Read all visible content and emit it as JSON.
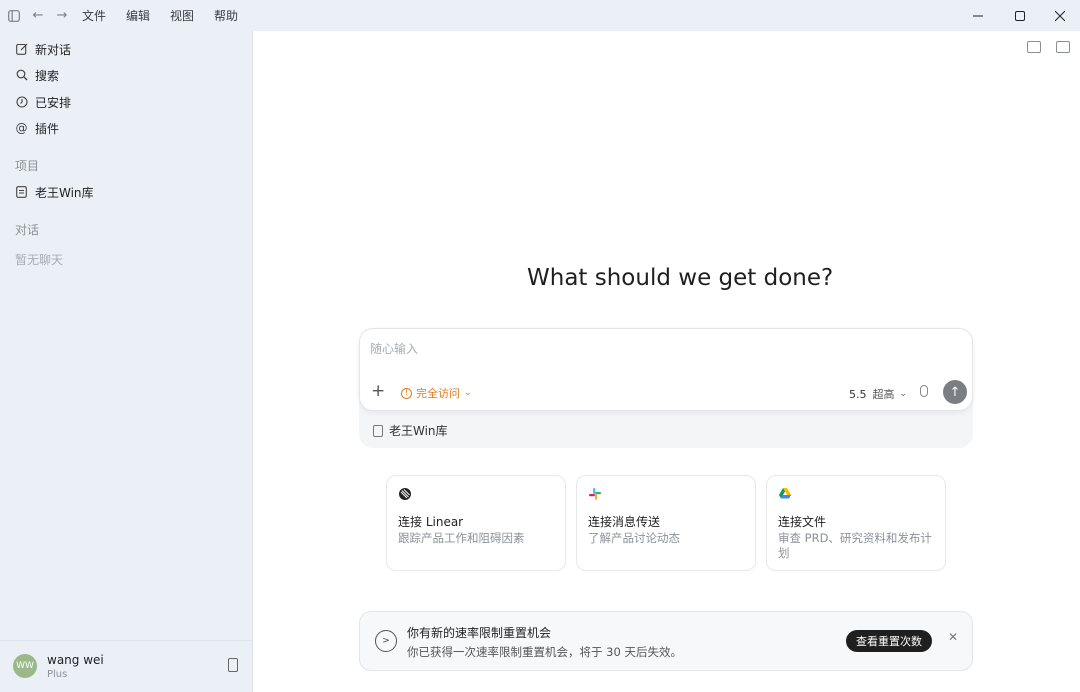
{
  "titlebar": {
    "menu": [
      "文件",
      "编辑",
      "视图",
      "帮助"
    ]
  },
  "sidebar": {
    "items": [
      {
        "label": "新对话",
        "icon": "edit-icon"
      },
      {
        "label": "搜索",
        "icon": "search-icon"
      },
      {
        "label": "已安排",
        "icon": "clock-icon"
      },
      {
        "label": "插件",
        "icon": "at-icon"
      }
    ],
    "projects_heading": "项目",
    "project": "老王Win库",
    "chats_heading": "对话",
    "chats_empty": "暂无聊天",
    "user": {
      "initials": "WW",
      "name": "wang wei",
      "plan": "Plus"
    }
  },
  "main": {
    "headline": "What should we get done?",
    "composer": {
      "placeholder": "随心输入",
      "access_label": "完全访问",
      "model": "5.5",
      "reasoning": "超高",
      "project_chip": "老王Win库"
    },
    "cards": [
      {
        "icon": "linear-icon",
        "title": "连接 Linear",
        "desc": "跟踪产品工作和阻碍因素"
      },
      {
        "icon": "slack-icon",
        "title": "连接消息传送",
        "desc": "了解产品讨论动态"
      },
      {
        "icon": "google-drive-icon",
        "title": "连接文件",
        "desc": "审查 PRD、研究资料和发布计划"
      }
    ],
    "notice": {
      "title": "你有新的速率限制重置机会",
      "desc": "你已获得一次速率限制重置机会，将于 30 天后失效。",
      "button": "查看重置次数"
    }
  }
}
